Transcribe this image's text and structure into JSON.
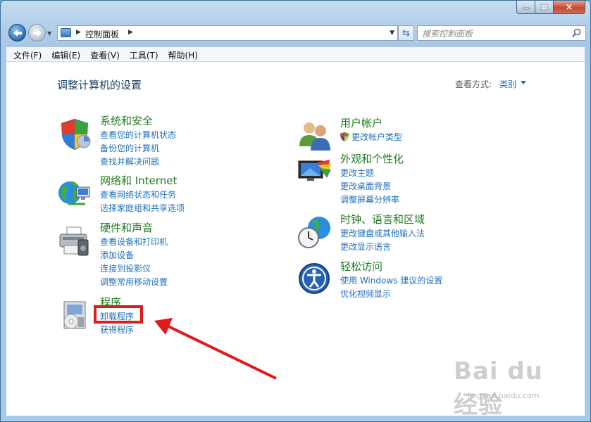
{
  "window": {
    "caption": {
      "minimize": "minimize",
      "maximize": "maximize",
      "close": "×"
    }
  },
  "nav": {
    "address_crumb": "控制面板",
    "search_placeholder": "搜索控制面板"
  },
  "menu": [
    "文件(F)",
    "编辑(E)",
    "查看(V)",
    "工具(T)",
    "帮助(H)"
  ],
  "content": {
    "heading": "调整计算机的设置",
    "view_by_label": "查看方式:",
    "view_by_value": "类别"
  },
  "categories": {
    "system_security": {
      "title": "系统和安全",
      "links": [
        "查看您的计算机状态",
        "备份您的计算机",
        "查找并解决问题"
      ]
    },
    "network": {
      "title": "网络和 Internet",
      "links": [
        "查看网络状态和任务",
        "选择家庭组和共享选项"
      ]
    },
    "hardware": {
      "title": "硬件和声音",
      "links": [
        "查看设备和打印机",
        "添加设备",
        "连接到投影仪",
        "调整常用移动设置"
      ]
    },
    "programs": {
      "title": "程序",
      "links": [
        "卸载程序",
        "获得程序"
      ]
    },
    "user_accounts": {
      "title": "用户帐户",
      "links": [
        "更改帐户类型"
      ]
    },
    "appearance": {
      "title": "外观和个性化",
      "links": [
        "更改主题",
        "更改桌面背景",
        "调整屏幕分辨率"
      ]
    },
    "clock": {
      "title": "时钟、语言和区域",
      "links": [
        "更改键盘或其他输入法",
        "更改显示语言"
      ]
    },
    "ease": {
      "title": "轻松访问",
      "links": [
        "使用 Windows 建议的设置",
        "优化视频显示"
      ]
    }
  },
  "watermark": {
    "brand": "Bai du 经验",
    "url": "jingyan.baidu.com"
  },
  "colors": {
    "link": "#1f6fbf",
    "category_title": "#1f7a1f",
    "highlight": "#e11a1a"
  }
}
